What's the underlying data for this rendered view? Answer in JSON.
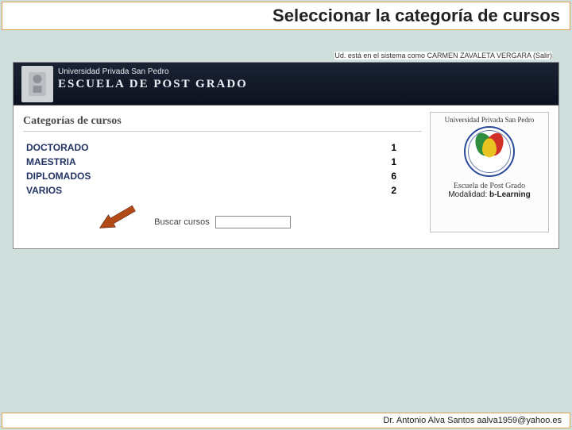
{
  "slide": {
    "title": "Seleccionar la categoría de cursos",
    "footer": "Dr. Antonio Alva Santos  aalva1959@yahoo.es"
  },
  "header": {
    "user_line": "Ud. está en el sistema como CARMEN ZAVALETA VERGARA (Salir)",
    "small": "Universidad Privada San Pedro",
    "big": "ESCUELA DE POST GRADO"
  },
  "section_heading": "Categorías de cursos",
  "categories": [
    {
      "name": "DOCTORADO",
      "count": "1"
    },
    {
      "name": "MAESTRIA",
      "count": "1"
    },
    {
      "name": "DIPLOMADOS",
      "count": "6"
    },
    {
      "name": "VARIOS",
      "count": "2"
    }
  ],
  "search": {
    "label": "Buscar cursos",
    "value": ""
  },
  "sidebox": {
    "top": "Universidad Privada San Pedro",
    "line1": "Escuela de Post Grado",
    "line2_prefix": "Modalidad: ",
    "line2_bold": "b-Learning"
  }
}
